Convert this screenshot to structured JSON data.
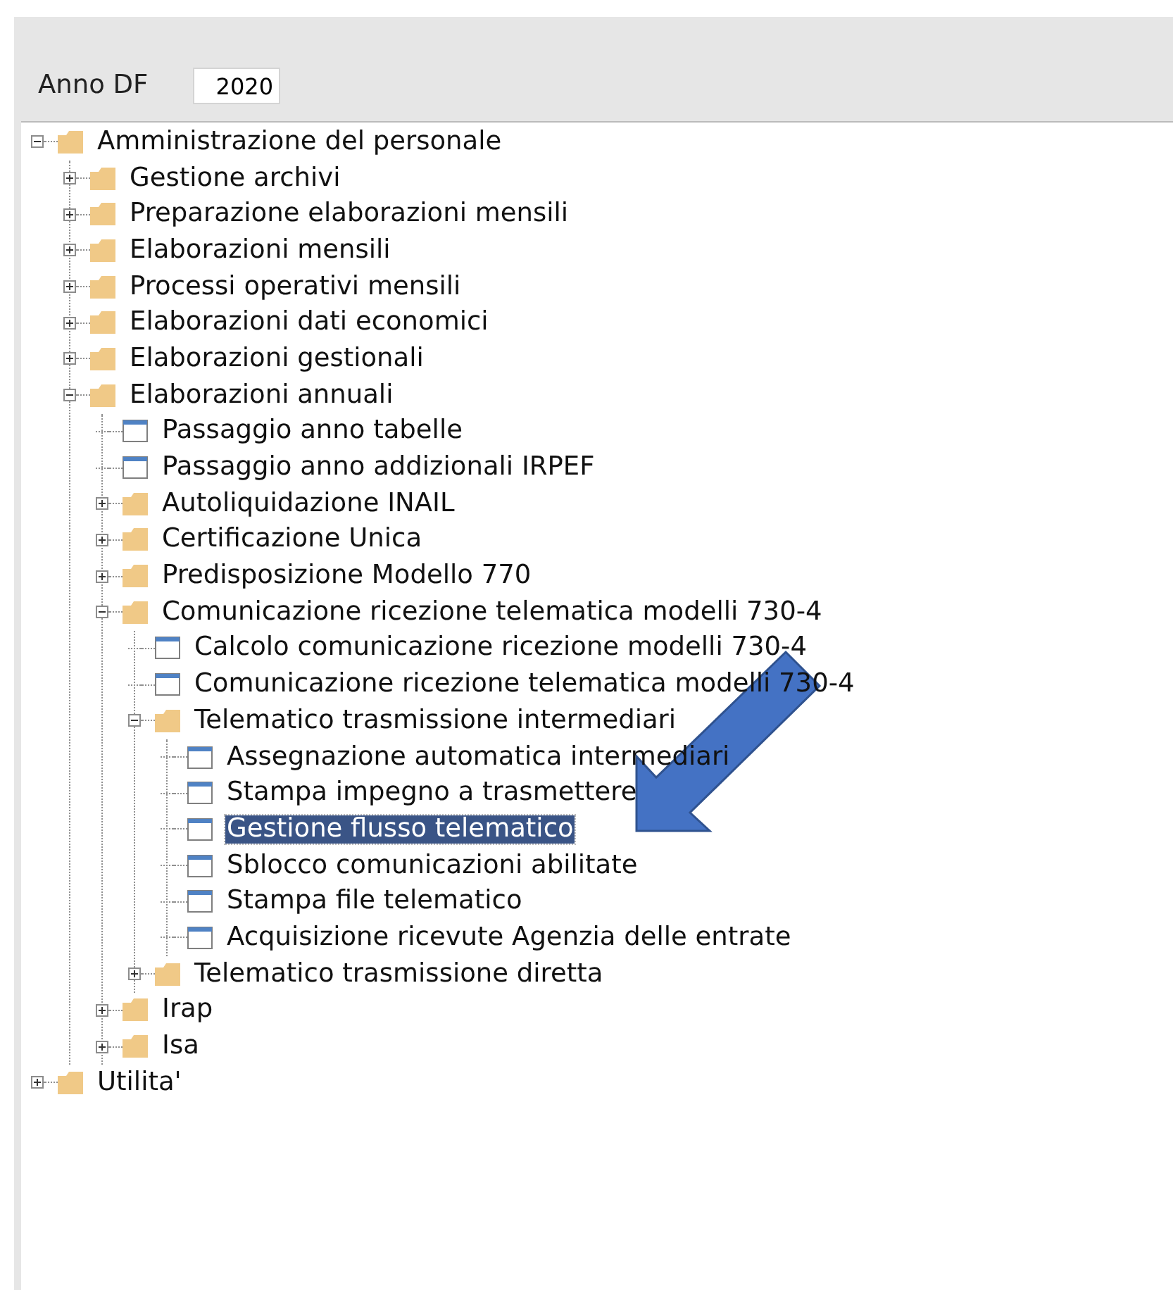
{
  "filter": {
    "label": "Anno DF",
    "value": "2020"
  },
  "tree": [
    {
      "kind": "folder",
      "label": "Amministrazione del personale",
      "expanded": true,
      "selected": false,
      "children": [
        {
          "kind": "folder",
          "label": "Gestione archivi",
          "expanded": false,
          "selected": false
        },
        {
          "kind": "folder",
          "label": "Preparazione elaborazioni mensili",
          "expanded": false,
          "selected": false
        },
        {
          "kind": "folder",
          "label": "Elaborazioni mensili",
          "expanded": false,
          "selected": false
        },
        {
          "kind": "folder",
          "label": "Processi operativi mensili",
          "expanded": false,
          "selected": false
        },
        {
          "kind": "folder",
          "label": "Elaborazioni dati economici",
          "expanded": false,
          "selected": false
        },
        {
          "kind": "folder",
          "label": "Elaborazioni gestionali",
          "expanded": false,
          "selected": false
        },
        {
          "kind": "folder",
          "label": "Elaborazioni annuali",
          "expanded": true,
          "selected": false,
          "children": [
            {
              "kind": "window",
              "label": "Passaggio anno tabelle",
              "selected": false
            },
            {
              "kind": "window",
              "label": "Passaggio anno addizionali IRPEF",
              "selected": false
            },
            {
              "kind": "folder",
              "label": "Autoliquidazione INAIL",
              "expanded": false,
              "selected": false
            },
            {
              "kind": "folder",
              "label": "Certificazione Unica",
              "expanded": false,
              "selected": false
            },
            {
              "kind": "folder",
              "label": "Predisposizione Modello 770",
              "expanded": false,
              "selected": false
            },
            {
              "kind": "folder",
              "label": "Comunicazione ricezione telematica modelli 730-4",
              "expanded": true,
              "selected": false,
              "children": [
                {
                  "kind": "window",
                  "label": "Calcolo comunicazione ricezione modelli 730-4",
                  "selected": false
                },
                {
                  "kind": "window",
                  "label": "Comunicazione ricezione telematica modelli 730-4",
                  "selected": false
                },
                {
                  "kind": "folder",
                  "label": "Telematico trasmissione intermediari",
                  "expanded": true,
                  "selected": false,
                  "children": [
                    {
                      "kind": "window",
                      "label": "Assegnazione automatica intermediari",
                      "selected": false
                    },
                    {
                      "kind": "window",
                      "label": "Stampa impegno a trasmettere",
                      "selected": false
                    },
                    {
                      "kind": "window",
                      "label": "Gestione flusso telematico",
                      "selected": true
                    },
                    {
                      "kind": "window",
                      "label": "Sblocco comunicazioni abilitate",
                      "selected": false
                    },
                    {
                      "kind": "window",
                      "label": "Stampa file telematico",
                      "selected": false
                    },
                    {
                      "kind": "window",
                      "label": "Acquisizione ricevute Agenzia delle entrate",
                      "selected": false
                    }
                  ]
                },
                {
                  "kind": "folder",
                  "label": "Telematico trasmissione diretta",
                  "expanded": false,
                  "selected": false
                }
              ]
            },
            {
              "kind": "folder",
              "label": "Irap",
              "expanded": false,
              "selected": false
            },
            {
              "kind": "folder",
              "label": "Isa",
              "expanded": false,
              "selected": false
            }
          ]
        }
      ]
    },
    {
      "kind": "folder",
      "label": "Utilita'",
      "expanded": false,
      "selected": false
    }
  ]
}
